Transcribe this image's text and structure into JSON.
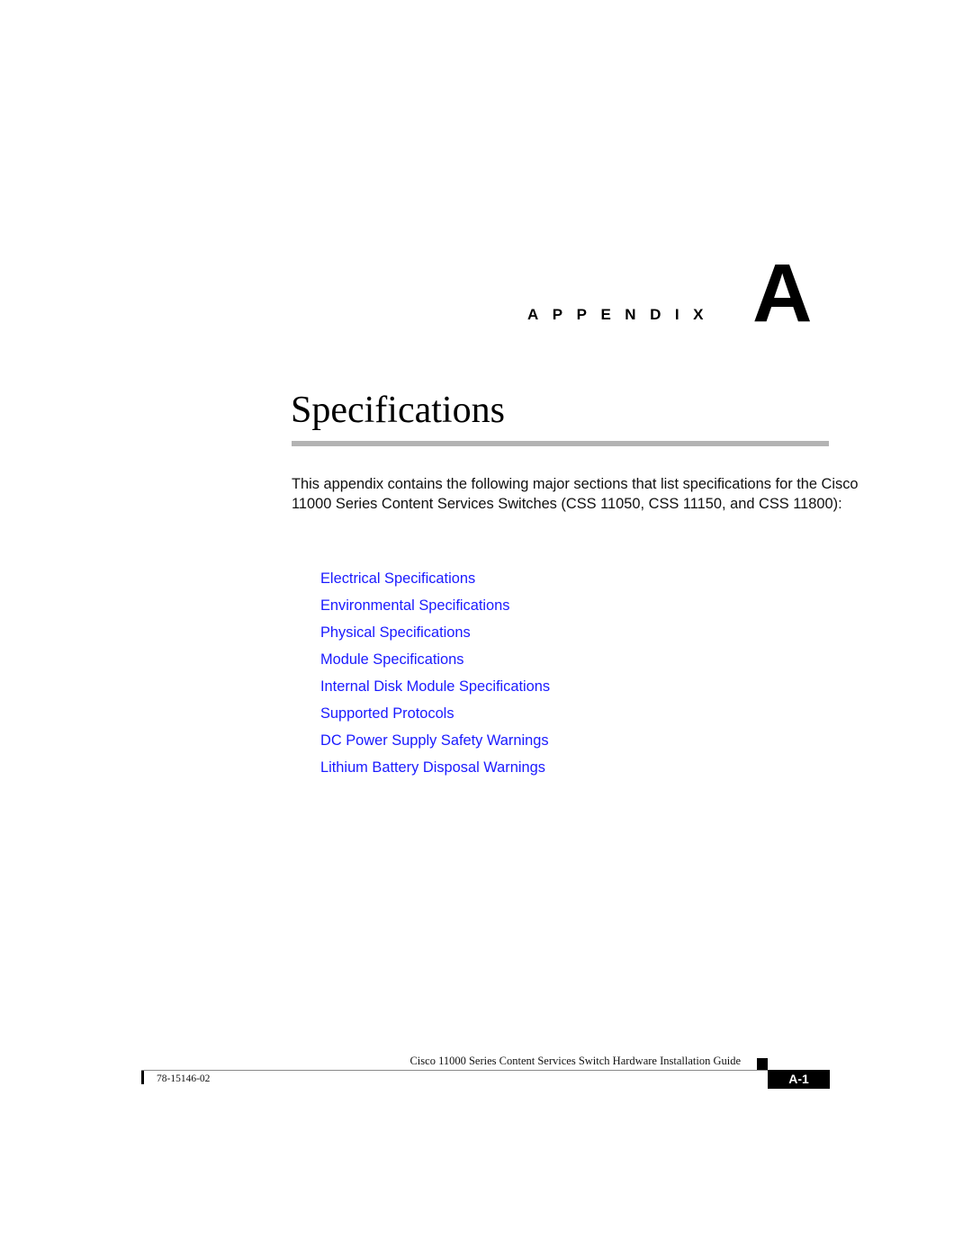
{
  "chapter": {
    "label": "APPENDIX",
    "letter": "A",
    "title": "Specifications"
  },
  "intro": "This appendix contains the following major sections that list specifications for the Cisco 11000 Series Content Services Switches (CSS 11050, CSS 11150, and CSS 11800):",
  "links": [
    "Electrical Specifications",
    "Environmental Specifications",
    "Physical Specifications",
    "Module Specifications",
    "Internal Disk Module Specifications",
    "Supported Protocols",
    "DC Power Supply Safety Warnings",
    "Lithium Battery Disposal Warnings"
  ],
  "footer": {
    "guide_title": "Cisco 11000 Series Content Services Switch Hardware Installation Guide",
    "doc_number": "78-15146-02",
    "page_number": "A-1"
  },
  "colors": {
    "link": "#1a1aff",
    "rule": "#b3b3b3"
  }
}
